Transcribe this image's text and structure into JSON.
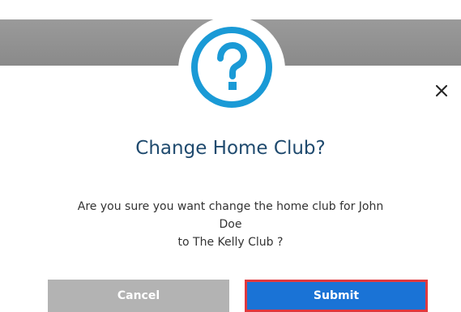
{
  "dialog": {
    "title": "Change Home Club?",
    "message_line1": "Are you sure you want change the home club for John Doe",
    "message_line2": "to The Kelly Club ?",
    "icon": "question-mark-icon",
    "close_icon": "close-icon",
    "cancel_label": "Cancel",
    "submit_label": "Submit"
  },
  "colors": {
    "accent": "#1a73d6",
    "icon_blue": "#1a9ad6",
    "title": "#1f4a6e",
    "cancel": "#b3b3b3",
    "highlight_border": "#e0393e"
  }
}
